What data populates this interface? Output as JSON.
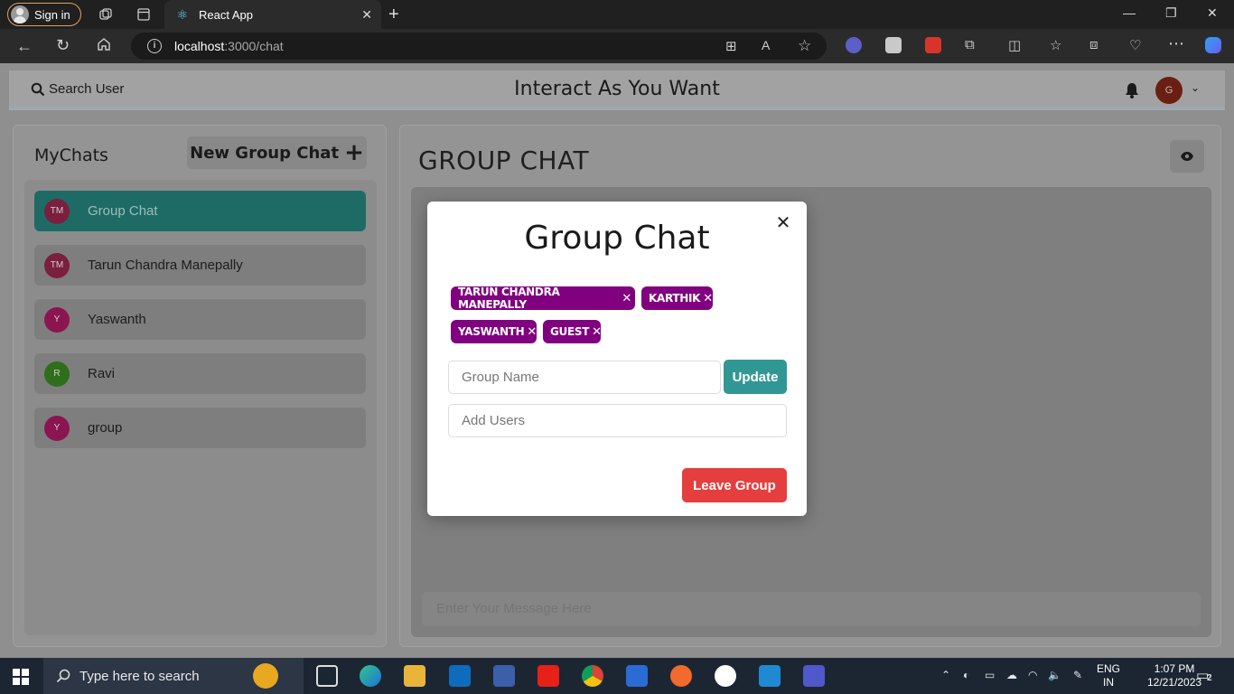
{
  "browser": {
    "signin_label": "Sign in",
    "tab_title": "React App",
    "url_host": "localhost",
    "url_path": ":3000/chat"
  },
  "header": {
    "search_label": "Search User",
    "title": "Interact As You Want",
    "user_initial": "G"
  },
  "sidebar": {
    "title": "MyChats",
    "new_group_label": "New Group Chat",
    "chats": [
      {
        "initials": "TM",
        "name": "Group Chat",
        "color": "#7a1f3d",
        "active": true
      },
      {
        "initials": "TM",
        "name": "Tarun Chandra Manepally",
        "color": "#7a1f3d",
        "active": false
      },
      {
        "initials": "Y",
        "name": "Yaswanth",
        "color": "#8a1550",
        "active": false
      },
      {
        "initials": "R",
        "name": "Ravi",
        "color": "#2f6e1a",
        "active": false
      },
      {
        "initials": "Y",
        "name": "group",
        "color": "#8a1550",
        "active": false
      }
    ]
  },
  "chat": {
    "title": "GROUP CHAT",
    "message_placeholder": "Enter Your Message Here"
  },
  "modal": {
    "title": "Group Chat",
    "members": [
      "TARUN CHANDRA MANEPALLY",
      "KARTHIK",
      "YASWANTH",
      "GUEST"
    ],
    "group_name_placeholder": "Group Name",
    "update_label": "Update",
    "add_users_placeholder": "Add Users",
    "leave_label": "Leave Group"
  },
  "taskbar": {
    "search_placeholder": "Type here to search",
    "lang_top": "ENG",
    "lang_bottom": "IN",
    "time": "1:07 PM",
    "date": "12/21/2023",
    "notification_count": "2"
  },
  "colors": {
    "accent_teal": "#319795",
    "badge_purple": "#800080",
    "danger_red": "#e53e3e"
  }
}
